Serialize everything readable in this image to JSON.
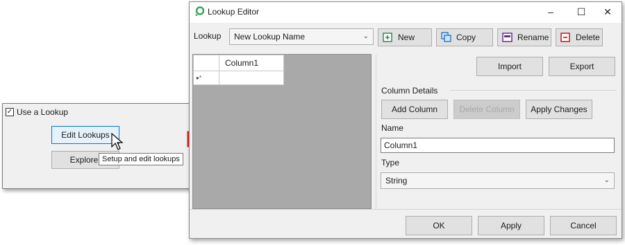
{
  "options_panel": {
    "use_lookup_label": "Use a Lookup",
    "use_lookup_checked": true,
    "edit_lookups_label": "Edit Lookups",
    "explorer_label": "Explorer",
    "tooltip": "Setup and edit lookups"
  },
  "editor": {
    "title": "Lookup Editor",
    "window_controls": {
      "minimize": "–",
      "maximize": "☐",
      "close": "✕"
    },
    "lookup_label": "Lookup",
    "lookup_value": "New Lookup Name",
    "toolbar": {
      "new": "New",
      "copy": "Copy",
      "rename": "Rename",
      "delete": "Delete"
    },
    "grid": {
      "column_header": "Column1",
      "row_marker": "▸*"
    },
    "import_label": "Import",
    "export_label": "Export",
    "column_details_label": "Column Details",
    "add_column_label": "Add Column",
    "delete_column_label": "Delete Column",
    "apply_changes_label": "Apply Changes",
    "name_label": "Name",
    "name_value": "Column1",
    "type_label": "Type",
    "type_value": "String",
    "ok_label": "OK",
    "apply_label": "Apply",
    "cancel_label": "Cancel"
  },
  "colors": {
    "arrow_fill": "#ffee00",
    "arrow_stroke": "#e0201a",
    "accent": "#0078d7"
  }
}
